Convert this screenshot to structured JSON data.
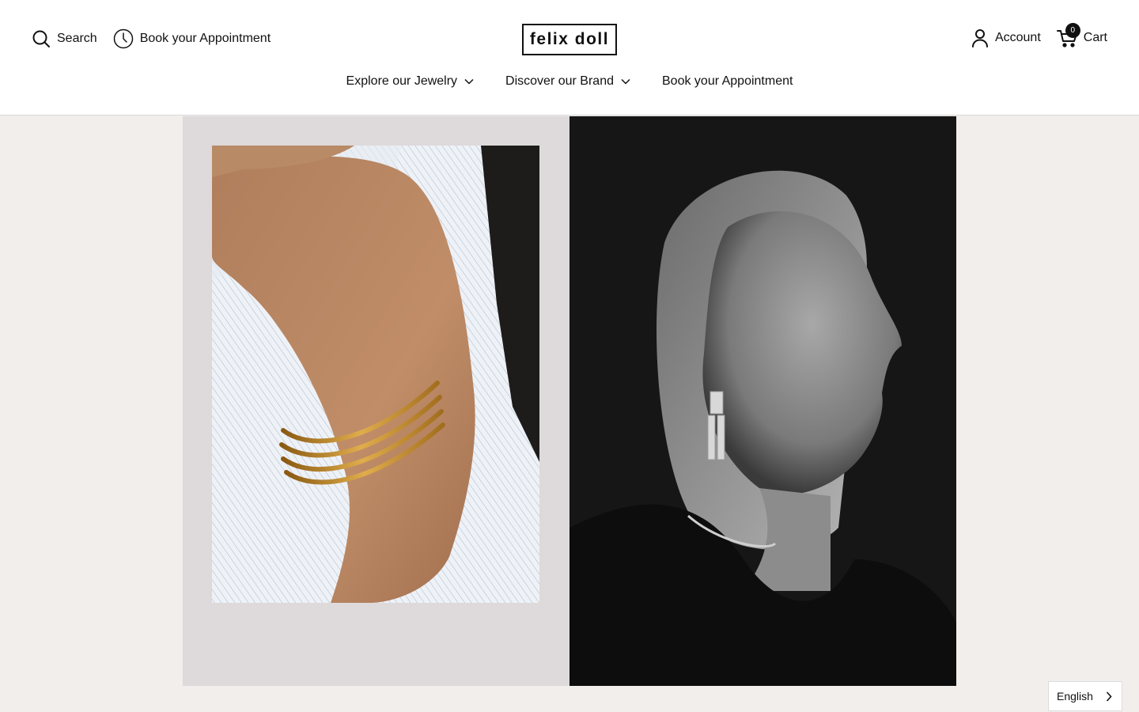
{
  "header": {
    "search_label": "Search",
    "book_label": "Book your Appointment",
    "logo_text": "felix doll",
    "account_label": "Account",
    "cart_label": "Cart",
    "cart_count": "0"
  },
  "nav": {
    "items": [
      {
        "label": "Explore our Jewelry",
        "has_dropdown": true
      },
      {
        "label": "Discover our Brand",
        "has_dropdown": true
      },
      {
        "label": "Book your Appointment",
        "has_dropdown": false
      }
    ]
  },
  "hero": {
    "left_image": "gold-bracelet-on-arm-photo",
    "right_image": "woman-profile-earring-photo"
  },
  "language_switcher": {
    "selected": "English"
  },
  "colors": {
    "page_bg": "#f2eeec",
    "left_panel_bg": "#ded9da",
    "header_bg": "#ffffff",
    "text": "#111111",
    "gold": "#c9922e"
  }
}
